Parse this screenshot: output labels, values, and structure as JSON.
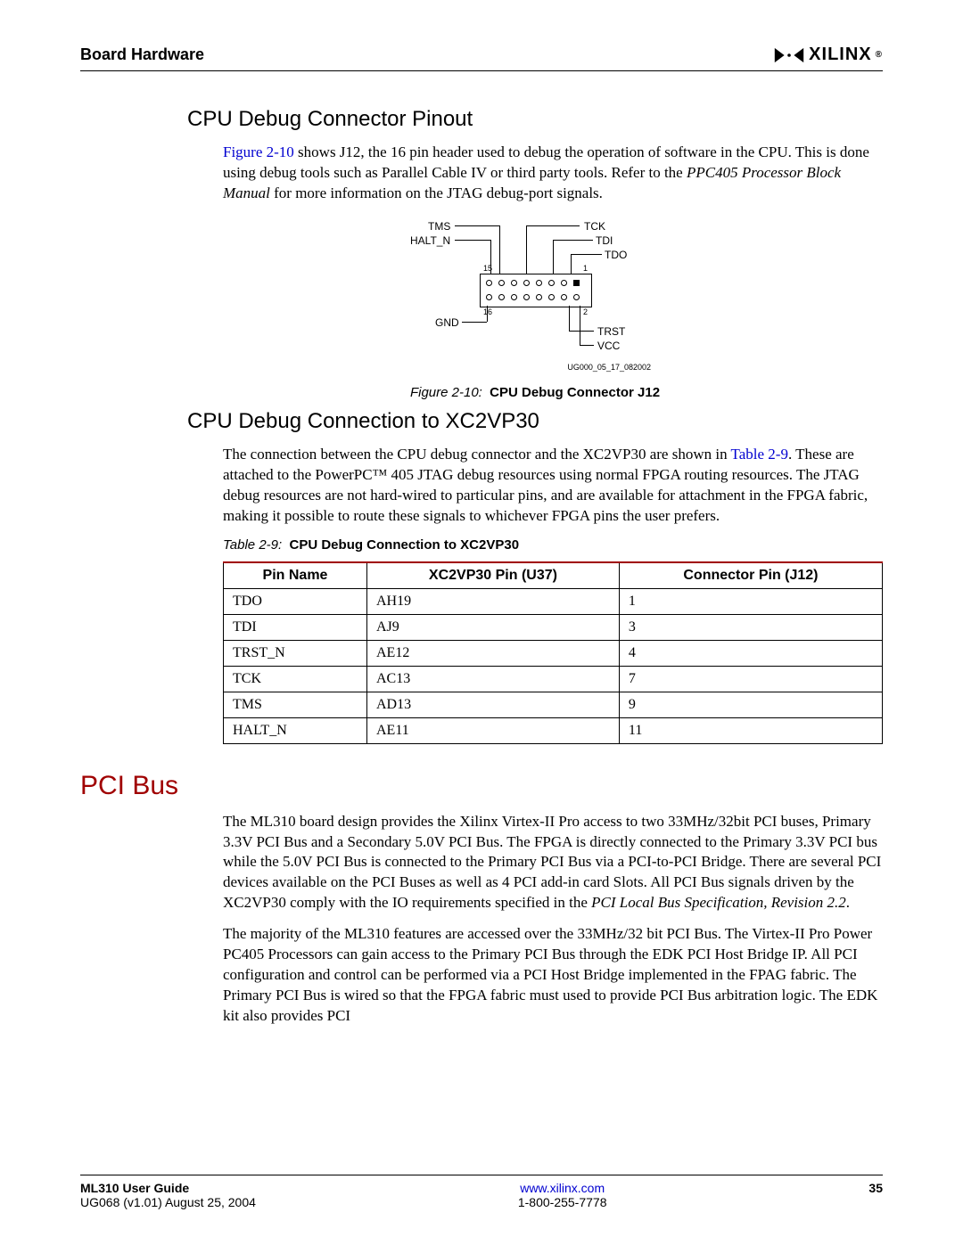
{
  "header": {
    "section": "Board Hardware",
    "brand": "XILINX"
  },
  "sect1": {
    "title": "CPU Debug Connector Pinout",
    "link": "Figure 2-10",
    "p1a": " shows J12, the 16 pin header used to debug the operation of software in the CPU. This is done using debug tools such as Parallel Cable IV or third party tools. Refer to the ",
    "ital": "PPC405 Processor Block Manual",
    "p1b": " for more information on the JTAG debug-port signals."
  },
  "figure": {
    "sig_tms": "TMS",
    "sig_haltn": "HALT_N",
    "sig_tck": "TCK",
    "sig_tdi": "TDI",
    "sig_tdo": "TDO",
    "sig_gnd": "GND",
    "sig_trst": "TRST",
    "sig_vcc": "VCC",
    "n1": "1",
    "n2": "2",
    "n15": "15",
    "n16": "16",
    "id": "UG000_05_17_082002",
    "cap_i": "Figure 2-10:",
    "cap_b": "CPU Debug Connector J12"
  },
  "sect2": {
    "title": "CPU Debug Connection to XC2VP30",
    "p1a": "The connection between the CPU debug connector and the XC2VP30 are shown in ",
    "link": "Table 2-9",
    "p1b": ". These are attached to the PowerPC™ 405 JTAG debug resources using normal FPGA routing resources. The JTAG debug resources are not hard-wired to particular pins, and are available for attachment in the FPGA fabric, making it possible to route these signals to whichever FPGA pins the user prefers."
  },
  "table": {
    "cap_i": "Table 2-9:",
    "cap_b": "CPU Debug Connection to XC2VP30",
    "h1": "Pin Name",
    "h2": "XC2VP30 Pin (U37)",
    "h3": "Connector Pin (J12)",
    "rows": [
      {
        "a": "TDO",
        "b": "AH19",
        "c": "1"
      },
      {
        "a": "TDI",
        "b": "AJ9",
        "c": "3"
      },
      {
        "a": "TRST_N",
        "b": "AE12",
        "c": "4"
      },
      {
        "a": "TCK",
        "b": "AC13",
        "c": "7"
      },
      {
        "a": "TMS",
        "b": "AD13",
        "c": "9"
      },
      {
        "a": "HALT_N",
        "b": "AE11",
        "c": "11"
      }
    ]
  },
  "sect3": {
    "title": "PCI Bus",
    "p1": "The ML310 board design provides the Xilinx Virtex-II Pro access to two 33MHz/32bit PCI buses, Primary 3.3V PCI Bus and a Secondary 5.0V PCI Bus. The FPGA is directly connected to the Primary 3.3V PCI bus while the 5.0V PCI Bus is connected to the Primary PCI Bus via a PCI-to-PCI Bridge. There are several PCI devices available on the PCI Buses as well as 4 PCI add-in card Slots. All PCI Bus signals driven by the XC2VP30 comply with the IO requirements specified in the ",
    "ital": "PCI Local Bus Specification, Revision 2.2",
    "p1b": ".",
    "p2": "The majority of the ML310 features are accessed over the 33MHz/32 bit PCI Bus. The Virtex-II Pro Power PC405 Processors can gain access to the Primary PCI Bus through the EDK PCI Host Bridge IP. All PCI configuration and control can be performed via a PCI Host Bridge implemented in the FPAG fabric. The Primary PCI Bus is wired so that the FPGA fabric must used to provide PCI Bus arbitration logic. The EDK kit also provides PCI"
  },
  "footer": {
    "title": "ML310 User Guide",
    "ver": "UG068 (v1.01) August 25, 2004",
    "url": "www.xilinx.com",
    "phone": "1-800-255-7778",
    "page": "35"
  }
}
